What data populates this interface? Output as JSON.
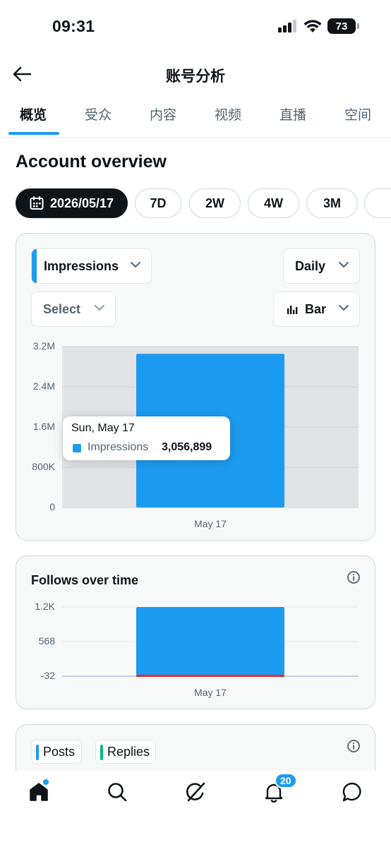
{
  "status_bar": {
    "time": "09:31",
    "battery": "73",
    "icons": [
      "signal-icon",
      "wifi-icon",
      "battery-icon"
    ]
  },
  "header": {
    "title": "账号分析",
    "back_icon": "arrow-left-icon"
  },
  "tabs": [
    {
      "label": "概览",
      "active": true
    },
    {
      "label": "受众",
      "active": false
    },
    {
      "label": "内容",
      "active": false
    },
    {
      "label": "视频",
      "active": false
    },
    {
      "label": "直播",
      "active": false
    },
    {
      "label": "空间",
      "active": false
    }
  ],
  "section_title": "Account overview",
  "ranges": {
    "selected_date": "2026/05/17",
    "options": [
      "7D",
      "2W",
      "4W",
      "3M"
    ]
  },
  "impressions_card": {
    "metric_dropdown": "Impressions",
    "interval_dropdown": "Daily",
    "compare_dropdown": "Select",
    "chart_type_dropdown": "Bar",
    "tooltip": {
      "date": "Sun, May 17",
      "series": "Impressions",
      "value": "3,056,899"
    }
  },
  "follows_card": {
    "title": "Follows over time"
  },
  "posts_card": {
    "legend": [
      {
        "label": "Posts",
        "color": "#1d9bf0"
      },
      {
        "label": "Replies",
        "color": "#00ba7c"
      }
    ]
  },
  "bottom_nav": {
    "items": [
      "home-icon",
      "search-icon",
      "grok-icon",
      "notifications-icon",
      "messages-icon"
    ],
    "notifications_badge": "20"
  },
  "colors": {
    "accent": "#1d9bf0",
    "negative": "#f4212e",
    "replies": "#00ba7c",
    "text": "#0f1419",
    "muted": "#536471"
  },
  "chart_data": [
    {
      "type": "bar",
      "categories": [
        "May 17"
      ],
      "series": [
        {
          "name": "Impressions",
          "values": [
            3056899
          ]
        }
      ],
      "yticks": [
        "0",
        "800K",
        "1.6M",
        "2.4M",
        "3.2M"
      ],
      "ylim": [
        0,
        3200000
      ],
      "grid": true
    },
    {
      "type": "bar",
      "title": "Follows over time",
      "categories": [
        "May 17"
      ],
      "series": [
        {
          "values": [
            1200
          ]
        },
        {
          "values": [
            -32
          ]
        }
      ],
      "yticks": [
        "-32",
        "568",
        "1.2K"
      ],
      "ylim": [
        -32,
        1200
      ],
      "grid": true
    }
  ]
}
